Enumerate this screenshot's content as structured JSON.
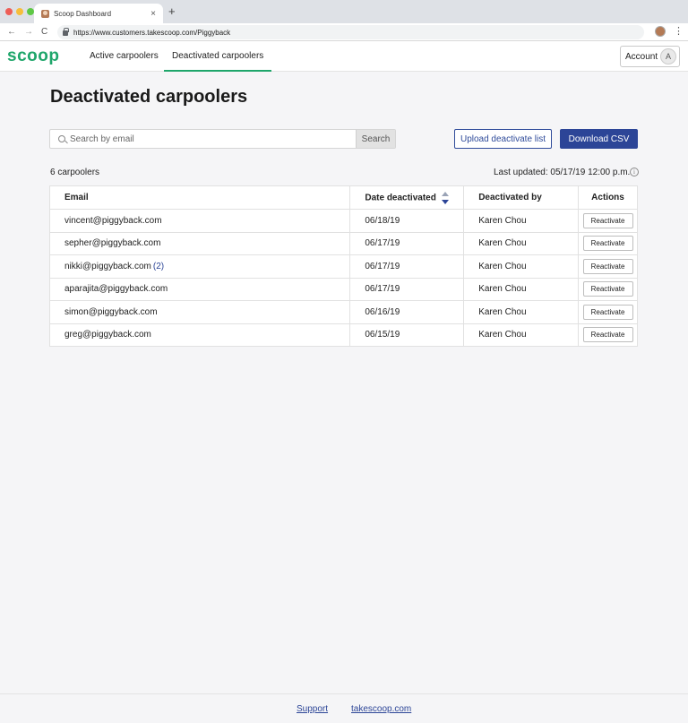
{
  "browser": {
    "tab_title": "Scoop Dashboard",
    "tab_close": "×",
    "new_tab": "+",
    "back": "←",
    "forward": "→",
    "reload": "C",
    "url": "https://www.customers.takescoop.com/Piggyback",
    "menu": "⋮"
  },
  "header": {
    "logo": "scoop",
    "nav": [
      {
        "label": "Active carpoolers",
        "active": false
      },
      {
        "label": "Deactivated carpoolers",
        "active": true
      }
    ],
    "account_label": "Account",
    "account_initial": "A"
  },
  "main": {
    "title": "Deactivated carpoolers",
    "search": {
      "placeholder": "Search by email",
      "button": "Search"
    },
    "upload_button": "Upload deactivate list",
    "download_button": "Download CSV",
    "count": "6 carpoolers",
    "last_updated": "Last updated: 05/17/19 12:00 p.m.",
    "info_glyph": "i"
  },
  "table": {
    "columns": [
      "Email",
      "Date deactivated",
      "Deactivated by",
      "Actions"
    ],
    "rows": [
      {
        "email": "vincent@piggyback.com",
        "dup": "",
        "date": "06/18/19",
        "by": "Karen Chou",
        "action": "Reactivate"
      },
      {
        "email": "sepher@piggyback.com",
        "dup": "",
        "date": "06/17/19",
        "by": "Karen Chou",
        "action": "Reactivate"
      },
      {
        "email": "nikki@piggyback.com",
        "dup": "(2)",
        "date": "06/17/19",
        "by": "Karen Chou",
        "action": "Reactivate"
      },
      {
        "email": "aparajita@piggyback.com",
        "dup": "",
        "date": "06/17/19",
        "by": "Karen Chou",
        "action": "Reactivate"
      },
      {
        "email": "simon@piggyback.com",
        "dup": "",
        "date": "06/16/19",
        "by": "Karen Chou",
        "action": "Reactivate"
      },
      {
        "email": "greg@piggyback.com",
        "dup": "",
        "date": "06/15/19",
        "by": "Karen Chou",
        "action": "Reactivate"
      }
    ]
  },
  "footer": {
    "links": [
      "Support",
      "takescoop.com"
    ]
  },
  "colors": {
    "brand_green": "#1fa66b",
    "primary_blue": "#2c4597"
  }
}
